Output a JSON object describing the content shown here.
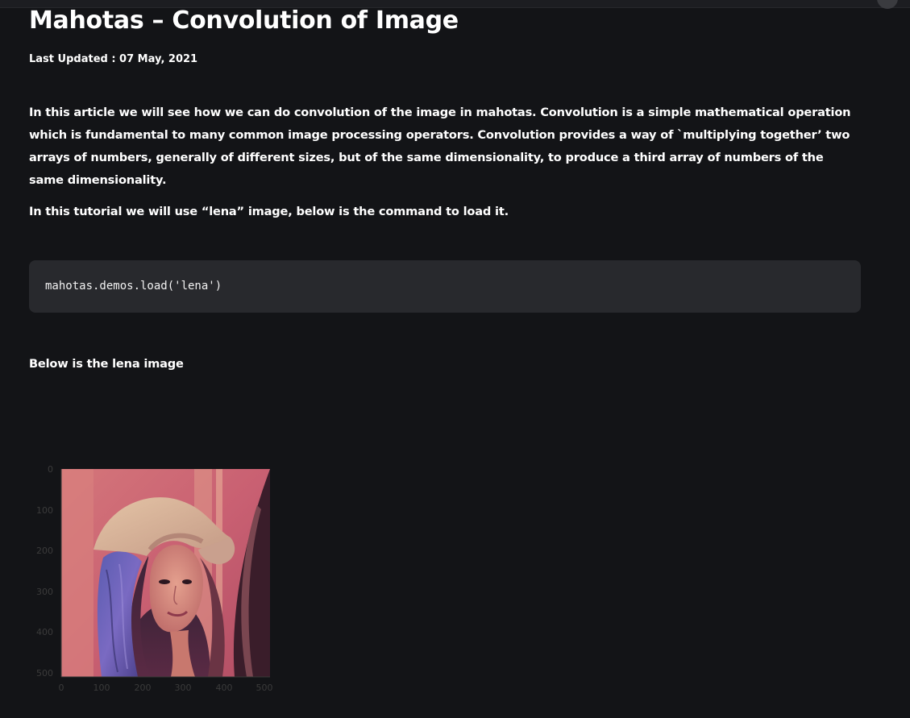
{
  "article": {
    "title": "Mahotas – Convolution of Image",
    "last_updated": "Last Updated : 07 May, 2021",
    "intro_paragraph": "In this article we will see how we can do convolution of the image in mahotas. Convolution is a simple mathematical operation which is fundamental to many common image processing operators. Convolution provides a way of `multiplying together’ two arrays of numbers, generally of different sizes, but of the same dimensionality, to produce a third array of numbers of the same dimensionality.",
    "tutorial_sentence": "In this tutorial we will use “lena” image, below is the command to load it.",
    "code": "mahotas.demos.load('lena')",
    "image_caption": "Below is the lena image"
  },
  "figure": {
    "x_tick_labels": [
      "0",
      "100",
      "200",
      "300",
      "400",
      "500"
    ],
    "y_tick_labels": [
      "0",
      "100",
      "200",
      "300",
      "400",
      "500"
    ],
    "image_extent": [
      0,
      512
    ]
  },
  "colors": {
    "page_background": "#131417",
    "code_background": "#28292d",
    "text": "#ffffff",
    "axis_label": "#3b3b3b"
  }
}
